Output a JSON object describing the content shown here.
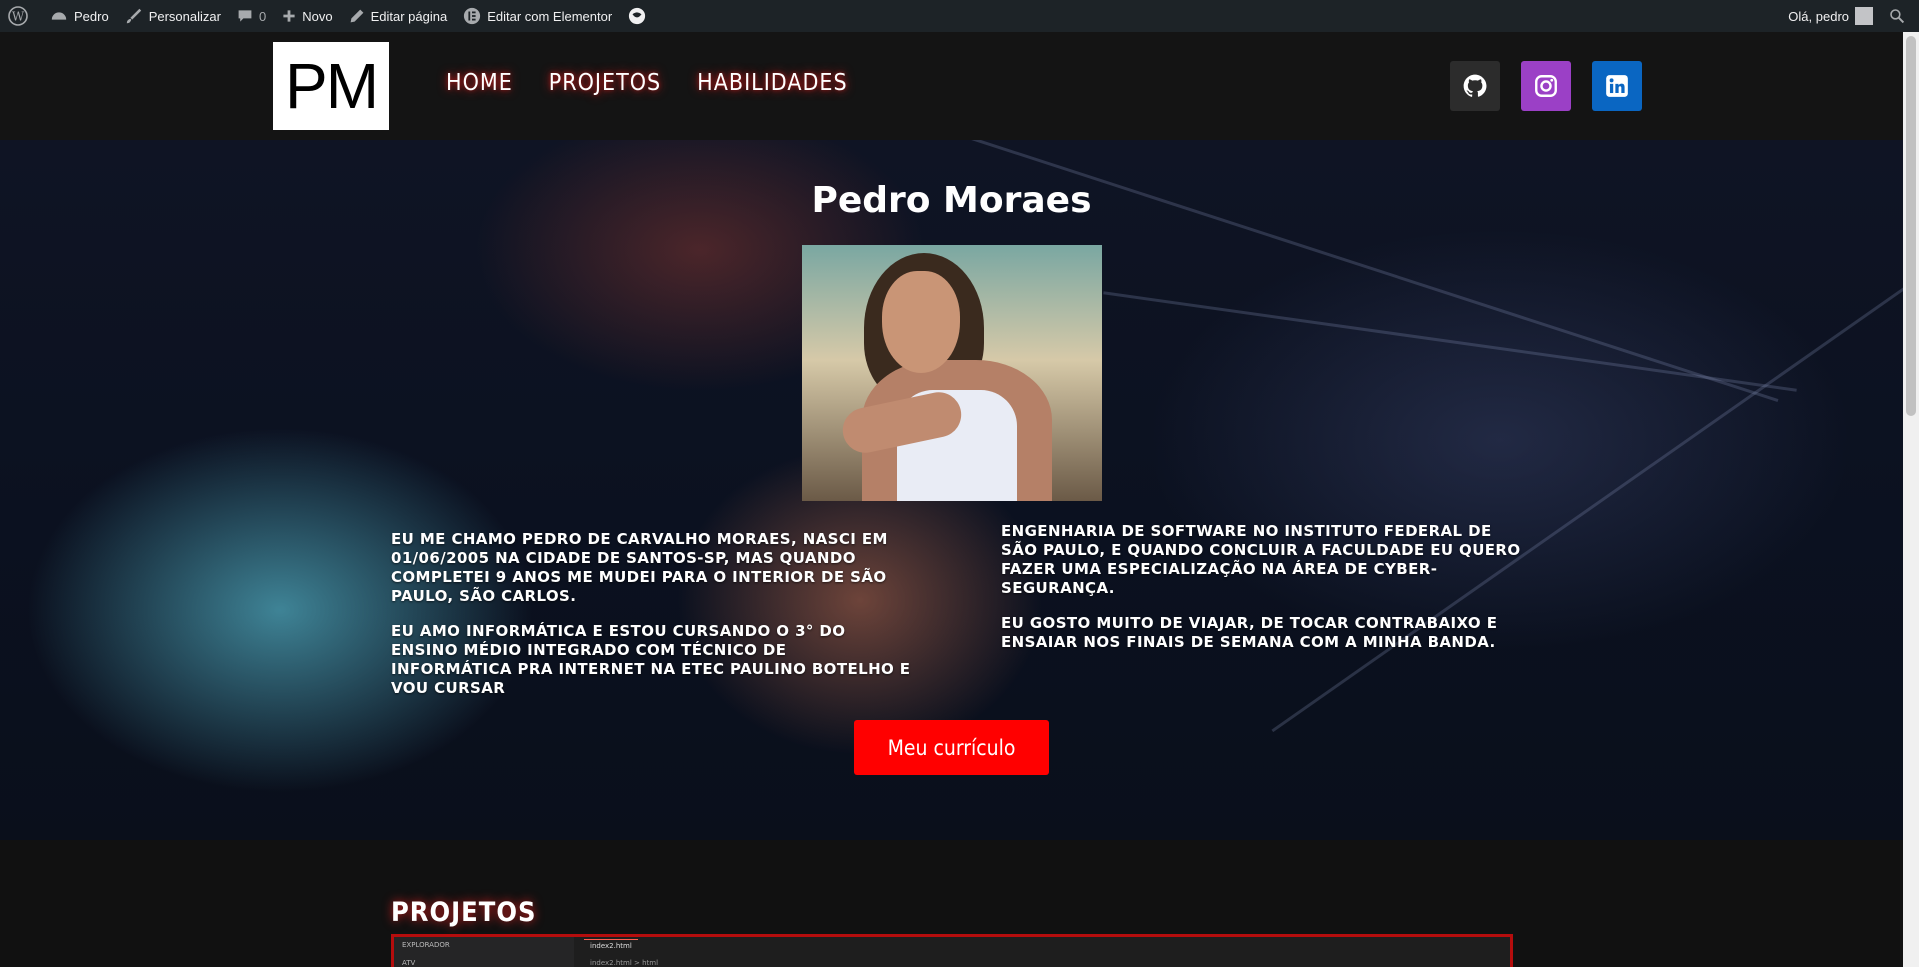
{
  "admin_bar": {
    "site_name": "Pedro",
    "customize": "Personalizar",
    "comments_count": "0",
    "new": "Novo",
    "edit_page": "Editar página",
    "edit_elementor": "Editar com Elementor",
    "greeting": "Olá, pedro"
  },
  "header": {
    "logo": "PM",
    "nav": [
      "HOME",
      "PROJETOS",
      "HABILIDADES"
    ],
    "social": [
      "github-icon",
      "instagram-icon",
      "linkedin-icon"
    ],
    "colors": {
      "github": "#2c2c2c",
      "instagram": "#9b40c6",
      "linkedin": "#0a66c2"
    }
  },
  "hero": {
    "title": "Pedro Moraes",
    "bio_left": [
      "EU ME CHAMO PEDRO DE CARVALHO MORAES, NASCI EM 01/06/2005 NA CIDADE DE SANTOS-SP, MAS QUANDO COMPLETEI 9 ANOS ME MUDEI PARA O INTERIOR DE SÃO PAULO, SÃO CARLOS.",
      "EU AMO INFORMÁTICA E ESTOU CURSANDO O 3° DO ENSINO MÉDIO INTEGRADO COM TÉCNICO DE INFORMÁTICA PRA INTERNET NA ETEC PAULINO BOTELHO E VOU CURSAR"
    ],
    "bio_right": [
      "ENGENHARIA DE SOFTWARE NO INSTITUTO FEDERAL DE SÃO PAULO, E QUANDO CONCLUIR A FACULDADE EU QUERO FAZER UMA ESPECIALIZAÇÃO NA ÁREA DE CYBER-SEGURANÇA.",
      "EU GOSTO MUITO DE VIAJAR, DE TOCAR CONTRABAIXO E ENSAIAR NOS FINAIS DE SEMANA COM A MINHA BANDA."
    ],
    "cv_button": "Meu currículo",
    "accent_color": "#ff0000"
  },
  "projects": {
    "title": "PROJETOS",
    "preview": {
      "explorer_label": "EXPLORADOR",
      "folder": "ATV",
      "tab": "index2.html",
      "breadcrumb": "index2.html > html"
    }
  }
}
